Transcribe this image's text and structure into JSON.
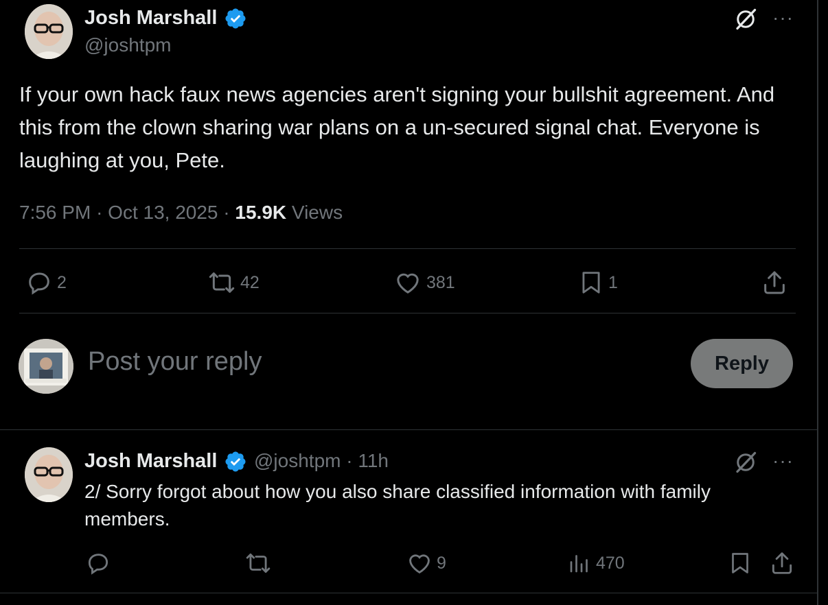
{
  "main_tweet": {
    "author_name": "Josh Marshall",
    "handle": "@joshtpm",
    "text": "If your own hack faux news agencies aren't signing your bullshit agreement. And this from the clown sharing war plans on a un-secured signal chat. Everyone is laughing at you, Pete.",
    "time": "7:56 PM",
    "date": "Oct 13, 2025",
    "views_count": "15.9K",
    "views_label": "Views",
    "replies": "2",
    "reposts": "42",
    "likes": "381",
    "bookmarks": "1"
  },
  "composer": {
    "placeholder": "Post your reply",
    "button_label": "Reply"
  },
  "reply_tweet": {
    "author_name": "Josh Marshall",
    "handle": "@joshtpm",
    "age": "11h",
    "text": "2/ Sorry forgot about how you also share classified information with family members.",
    "likes": "9",
    "views": "470"
  },
  "icons": {
    "verified": "verified-badge-icon",
    "grok": "grok-icon",
    "more": "more-icon"
  },
  "colors": {
    "background": "#000000",
    "text": "#e7e9ea",
    "muted": "#71767b",
    "verified": "#1d9bf0",
    "divider": "#2f3336"
  }
}
